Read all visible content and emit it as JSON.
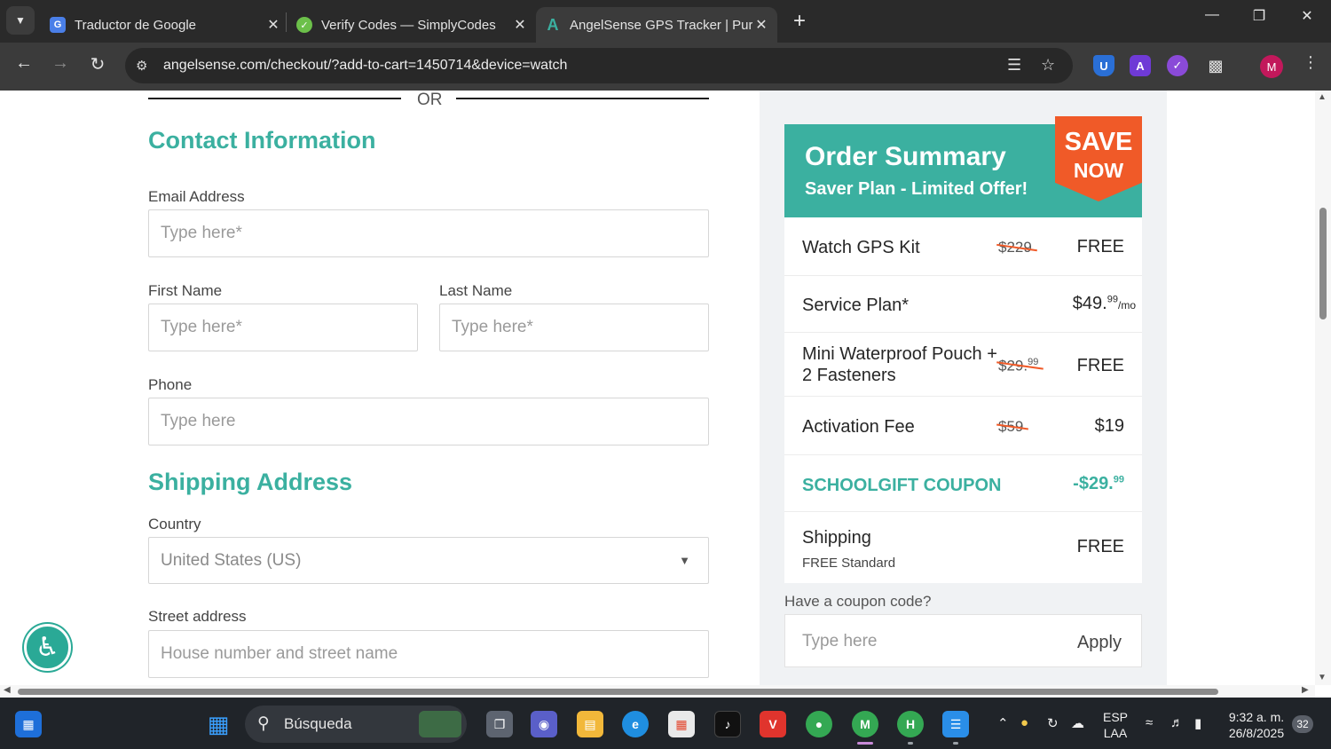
{
  "browser": {
    "tabs": [
      {
        "title": "Traductor de Google",
        "icon": "google-translate-icon",
        "active": false
      },
      {
        "title": "Verify Codes — SimplyCodes",
        "icon": "simplycodes-icon",
        "active": false
      },
      {
        "title": "AngelSense GPS Tracker | Purch",
        "icon": "angelsense-icon",
        "active": true
      }
    ],
    "new_tab_symbol": "+",
    "url": "angelsense.com/checkout/?add-to-cart=1450714&device=watch",
    "profile_initial": "M"
  },
  "form": {
    "or_text": "OR",
    "contact_title": "Contact Information",
    "email_label": "Email Address",
    "email_placeholder": "Type here*",
    "first_name_label": "First Name",
    "first_name_placeholder": "Type here*",
    "last_name_label": "Last Name",
    "last_name_placeholder": "Type here*",
    "phone_label": "Phone",
    "phone_placeholder": "Type here",
    "shipping_title": "Shipping Address",
    "country_label": "Country",
    "country_value": "United States (US)",
    "street_label": "Street address",
    "street_placeholder": "House number and street name"
  },
  "summary": {
    "title": "Order Summary",
    "subtitle": "Saver Plan - Limited Offer!",
    "badge_line1": "SAVE",
    "badge_line2": "NOW",
    "rows": [
      {
        "name": "Watch GPS Kit",
        "old_price": "$229",
        "price": "FREE"
      },
      {
        "name": "Service Plan*",
        "price_main": "$49.",
        "price_cents": "99",
        "price_unit": "/mo"
      },
      {
        "name_line1": "Mini Waterproof Pouch +",
        "name_line2": "2 Fasteners",
        "old_price_main": "$29.",
        "old_price_cents": "99",
        "price": "FREE"
      },
      {
        "name": "Activation Fee",
        "old_price": "$59",
        "price": "$19"
      },
      {
        "name": "SCHOOLGIFT COUPON",
        "price_main": "-$29.",
        "price_cents": "99"
      },
      {
        "name": "Shipping",
        "sub": "FREE Standard",
        "price": "FREE"
      }
    ],
    "coupon_label": "Have a coupon code?",
    "coupon_placeholder": "Type here",
    "apply_label": "Apply"
  },
  "taskbar": {
    "search_label": "Búsqueda",
    "language_line1": "ESP",
    "language_line2": "LAA",
    "time": "9:32 a. m.",
    "date": "26/8/2025",
    "notification_count": "32"
  },
  "colors": {
    "accent": "#3bb0a0",
    "badge": "#f05a28"
  }
}
